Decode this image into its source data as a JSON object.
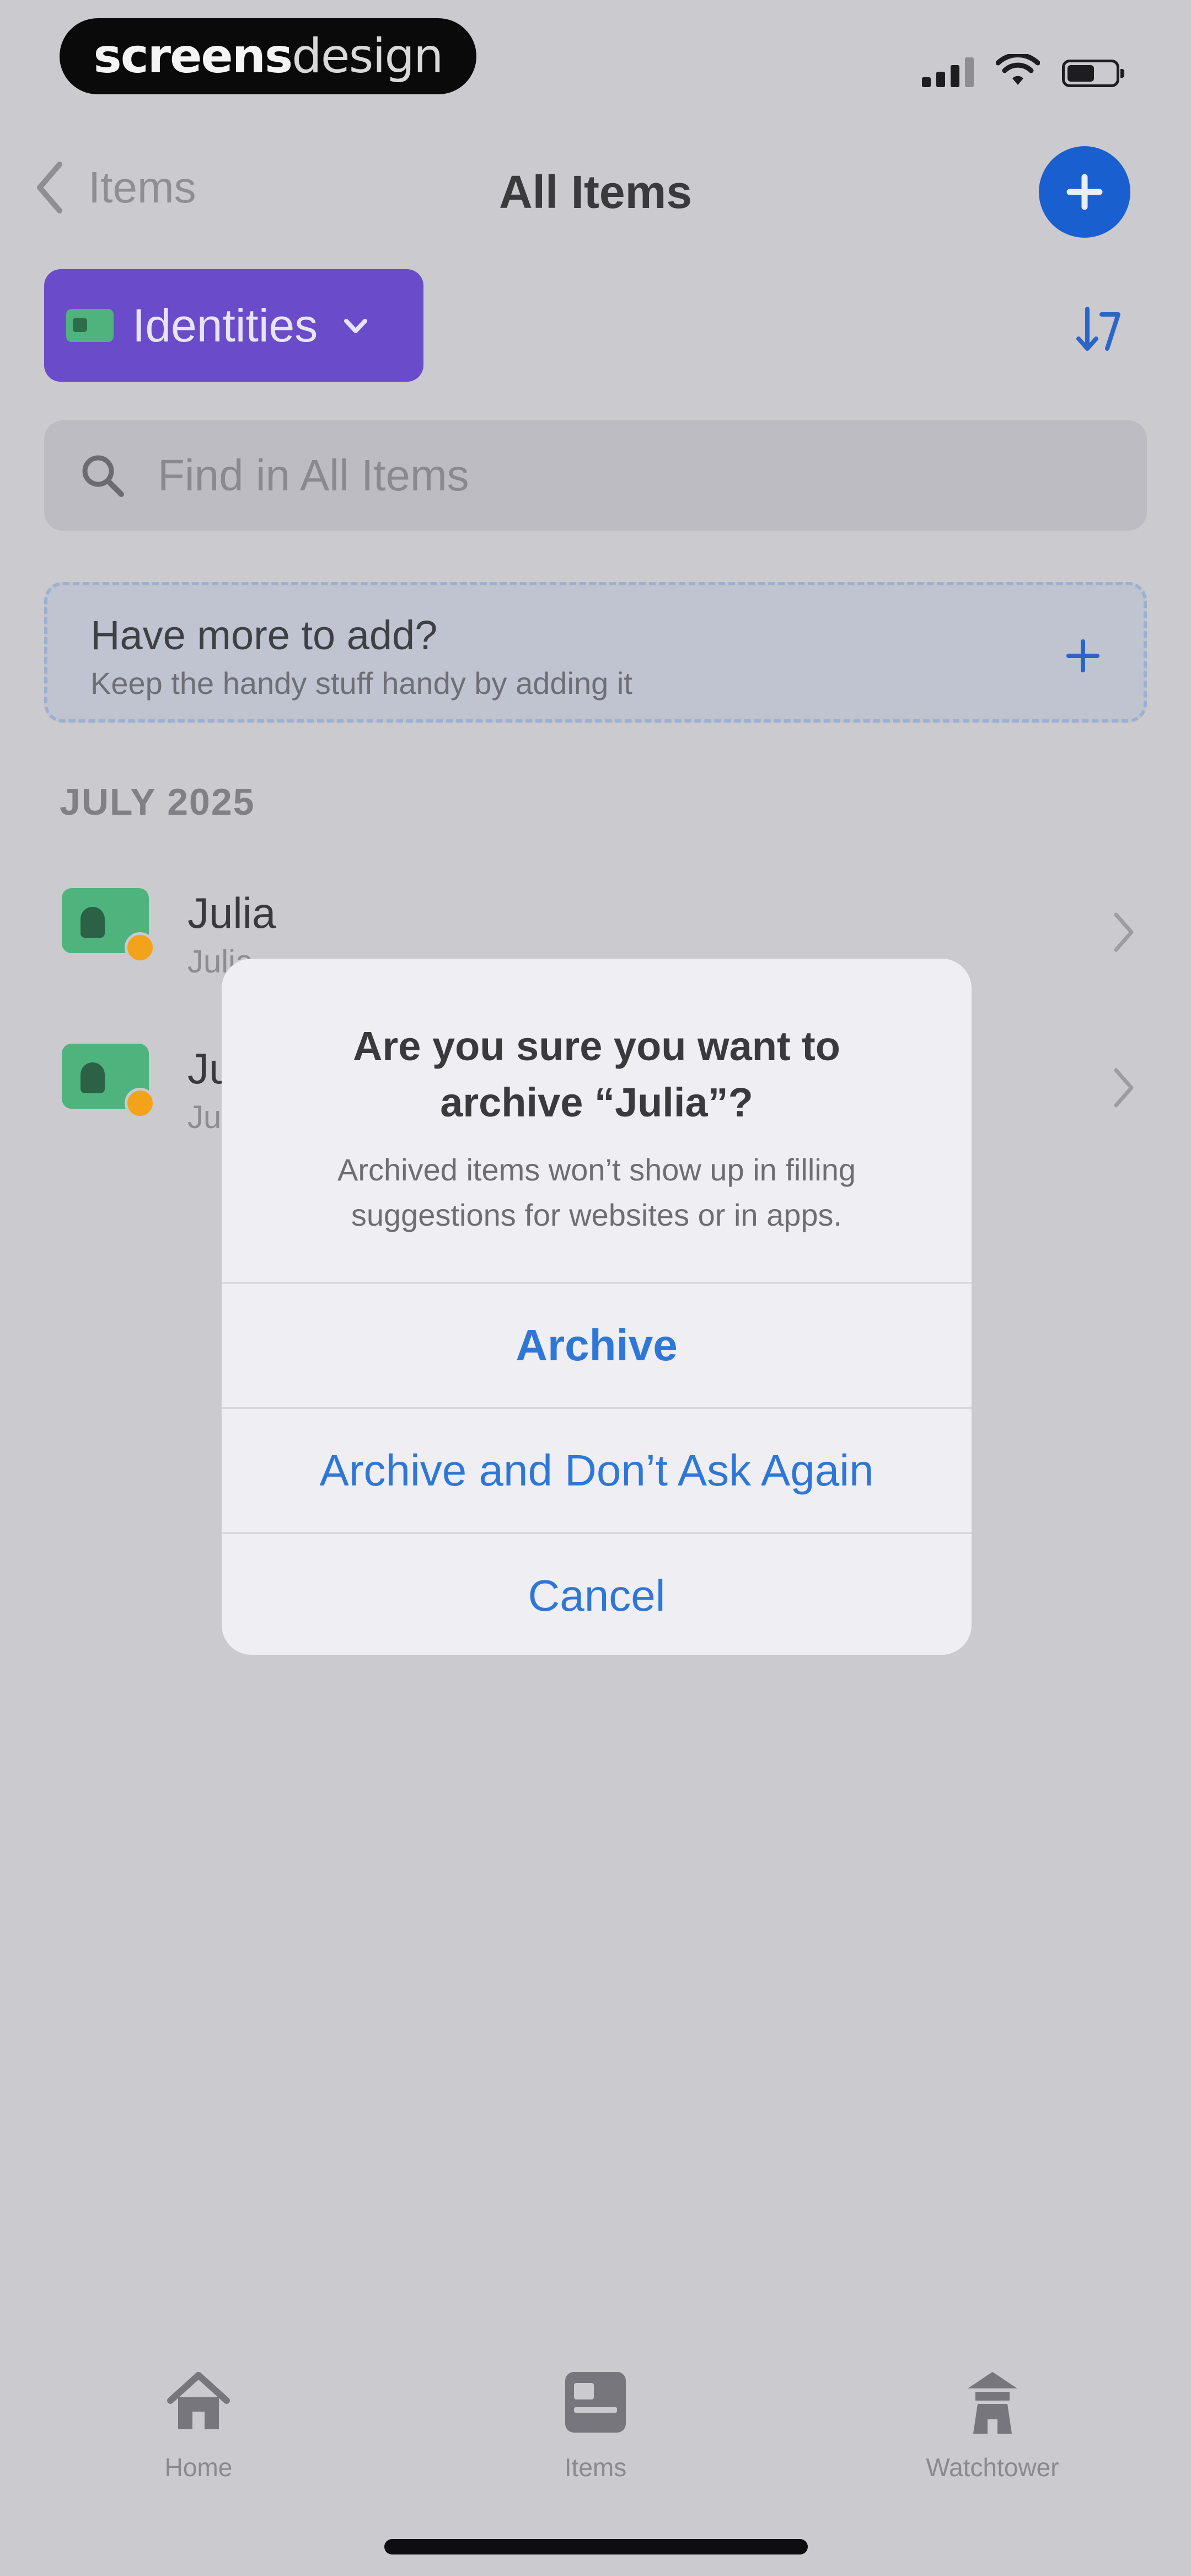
{
  "status_bar": {
    "brand_bold": "screens",
    "brand_light": "design"
  },
  "nav": {
    "back_label": "Items",
    "title": "All Items"
  },
  "filter": {
    "label": "Identities"
  },
  "search": {
    "placeholder": "Find in All Items"
  },
  "promo": {
    "title": "Have more to add?",
    "subtitle": "Keep the handy stuff handy by adding it"
  },
  "list": {
    "section": "JULY 2025",
    "items": [
      {
        "name": "Julia",
        "subtitle": "Julia"
      },
      {
        "name": "Ju",
        "subtitle": "Ju"
      }
    ]
  },
  "dialog": {
    "title_line1": "Are you sure you want to",
    "title_line2": "archive “Julia”?",
    "message_line1": "Archived items won’t show up in filling",
    "message_line2": "suggestions for websites or in apps.",
    "archive": "Archive",
    "archive_dont_ask": "Archive and Don’t Ask Again",
    "cancel": "Cancel"
  },
  "tabbar": {
    "tabs": [
      {
        "label": "Home",
        "icon": "home-icon"
      },
      {
        "label": "Items",
        "icon": "items-icon"
      },
      {
        "label": "Watchtower",
        "icon": "watchtower-icon"
      }
    ]
  },
  "colors": {
    "accent": "#1a5fd0",
    "filter_purple": "#6a4bc9",
    "identity_green": "#4fb37d",
    "favorite_orange": "#f2a21b",
    "dialog_action_blue": "#2f77d6"
  }
}
